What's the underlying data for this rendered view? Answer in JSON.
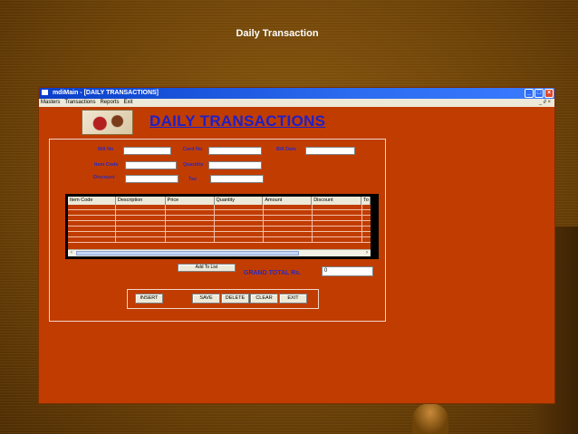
{
  "slide": {
    "title": "Daily Transaction"
  },
  "window": {
    "title": "mdiMain - [DAILY TRANSACTIONS]",
    "controls": {
      "minimize": "_",
      "maximize": "□",
      "close": "×"
    }
  },
  "menubar": {
    "items": [
      "Masters",
      "Transactions",
      "Reports",
      "Exit"
    ],
    "mdi_controls": "_ ∂ ×"
  },
  "form": {
    "title": "DAILY TRANSACTIONS",
    "fields": {
      "bill_no": {
        "label": "Bill No",
        "value": ""
      },
      "card_no": {
        "label": "Card No",
        "value": ""
      },
      "bill_date": {
        "label": "Bill Date",
        "value": ""
      },
      "item_code": {
        "label": "Item Code",
        "value": ""
      },
      "quantity": {
        "label": "Quantity",
        "value": ""
      },
      "discount": {
        "label": "Discount",
        "value": ""
      },
      "tax": {
        "label": "Tax",
        "value": ""
      }
    },
    "grid": {
      "columns": [
        "Item Code",
        "Description",
        "Price",
        "Quantity",
        "Amount",
        "Discount",
        "To"
      ],
      "rows": []
    },
    "add_to_list_label": "Add To List",
    "grand_total": {
      "label": "GRAND TOTAL  Rs.",
      "value": "0"
    },
    "buttons": {
      "insert": "INSERT",
      "save": "SAVE",
      "delete": "DELETE",
      "clear": "CLEAR",
      "exit": "EXIT"
    }
  },
  "colors": {
    "form_bg": "#c13c00",
    "label_blue": "#2a2ac0",
    "title_blue": "#1f20c8",
    "titlebar_blue": "#0a3ec9"
  }
}
